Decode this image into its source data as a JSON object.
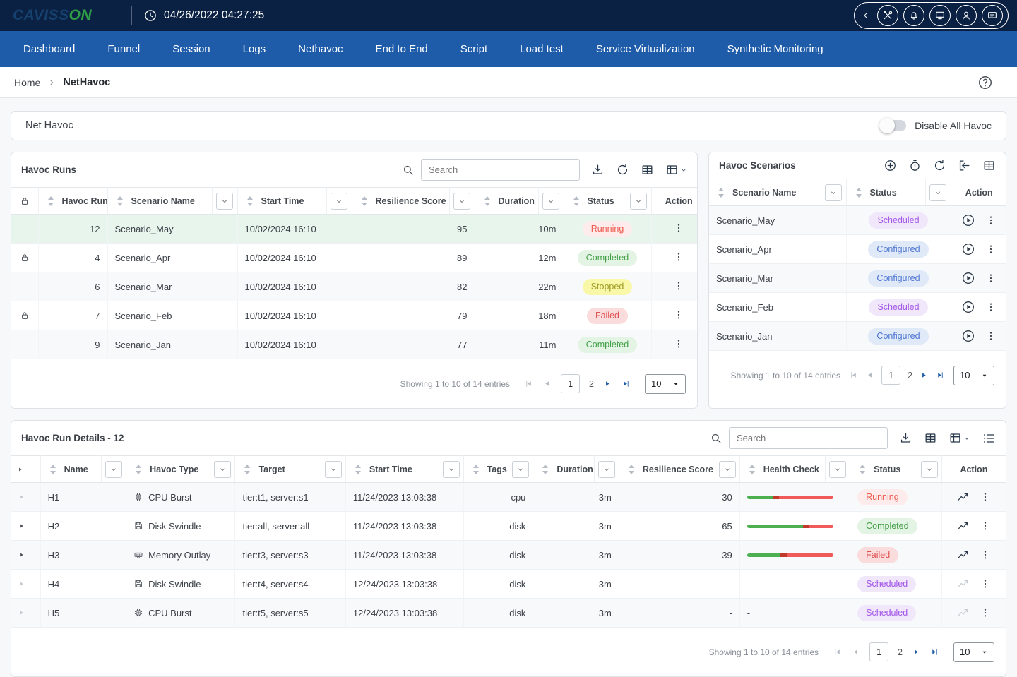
{
  "topbar": {
    "brand_part1": "CAVISS",
    "brand_part2": "ON",
    "timestamp": "04/26/2022 04:27:25"
  },
  "nav": {
    "items": [
      "Dashboard",
      "Funnel",
      "Session",
      "Logs",
      "Nethavoc",
      "End to End",
      "Script",
      "Load test",
      "Service Virtualization",
      "Synthetic Monitoring"
    ]
  },
  "breadcrumb": {
    "home": "Home",
    "current": "NetHavoc"
  },
  "net_havoc_bar": {
    "title": "Net Havoc",
    "toggle_label": "Disable All Havoc"
  },
  "havoc_runs": {
    "title": "Havoc Runs",
    "search_placeholder": "Search",
    "columns": [
      "Havoc Run",
      "Scenario Name",
      "Start Time",
      "Resilience Score",
      "Duration",
      "Status",
      "Action"
    ],
    "rows": [
      {
        "run": "12",
        "scenario": "Scenario_May",
        "start": "10/02/2024 16:10",
        "score": "95",
        "duration": "10m",
        "status": "Running",
        "status_class": "running"
      },
      {
        "run": "4",
        "scenario": "Scenario_Apr",
        "start": "10/02/2024 16:10",
        "score": "89",
        "duration": "12m",
        "status": "Completed",
        "status_class": "completed"
      },
      {
        "run": "6",
        "scenario": "Scenario_Mar",
        "start": "10/02/2024 16:10",
        "score": "82",
        "duration": "22m",
        "status": "Stopped",
        "status_class": "stopped"
      },
      {
        "run": "7",
        "scenario": "Scenario_Feb",
        "start": "10/02/2024 16:10",
        "score": "79",
        "duration": "18m",
        "status": "Failed",
        "status_class": "failed"
      },
      {
        "run": "9",
        "scenario": "Scenario_Jan",
        "start": "10/02/2024 16:10",
        "score": "77",
        "duration": "11m",
        "status": "Completed",
        "status_class": "completed"
      }
    ],
    "footer": {
      "showing": "Showing 1 to 10 of 14 entries",
      "page1": "1",
      "page2": "2",
      "page_size": "10"
    }
  },
  "havoc_scenarios": {
    "title": "Havoc Scenarios",
    "columns": [
      "Scenario Name",
      "Status",
      "Action"
    ],
    "rows": [
      {
        "name": "Scenario_May",
        "status": "Scheduled",
        "status_class": "scheduled"
      },
      {
        "name": "Scenario_Apr",
        "status": "Configured",
        "status_class": "configured"
      },
      {
        "name": "Scenario_Mar",
        "status": "Configured",
        "status_class": "configured"
      },
      {
        "name": "Scenario_Feb",
        "status": "Scheduled",
        "status_class": "scheduled"
      },
      {
        "name": "Scenario_Jan",
        "status": "Configured",
        "status_class": "configured"
      }
    ],
    "footer": {
      "showing": "Showing 1 to 10 of 14 entries",
      "page1": "1",
      "page2": "2",
      "page_size": "10"
    }
  },
  "run_details": {
    "title": "Havoc Run Details - 12",
    "search_placeholder": "Search",
    "columns": [
      "Name",
      "Havoc Type",
      "Target",
      "Start Time",
      "Tags",
      "Duration",
      "Resilience Score",
      "Health Check",
      "Status",
      "Action"
    ],
    "rows": [
      {
        "name": "H1",
        "type": "CPU Burst",
        "target": "tier:t1, server:s1",
        "start": "11/24/2023 13:03:38",
        "tags": "cpu",
        "duration": "3m",
        "score": "30",
        "health_pct": 30,
        "status": "Running",
        "status_class": "running"
      },
      {
        "name": "H2",
        "type": "Disk Swindle",
        "target": "tier:all, server:all",
        "start": "11/24/2023 13:03:38",
        "tags": "disk",
        "duration": "3m",
        "score": "65",
        "health_pct": 65,
        "status": "Completed",
        "status_class": "completed"
      },
      {
        "name": "H3",
        "type": "Memory Outlay",
        "target": "tier:t3, server:s3",
        "start": "11/24/2023 13:03:38",
        "tags": "disk",
        "duration": "3m",
        "score": "39",
        "health_pct": 39,
        "status": "Failed",
        "status_class": "failed"
      },
      {
        "name": "H4",
        "type": "Disk Swindle",
        "target": "tier:t4, server:s4",
        "start": "12/24/2023 13:03:38",
        "tags": "disk",
        "duration": "3m",
        "score": "-",
        "health_text": "-",
        "status": "Scheduled",
        "status_class": "scheduled"
      },
      {
        "name": "H5",
        "type": "CPU Burst",
        "target": "tier:t5, server:s5",
        "start": "12/24/2023 13:03:38",
        "tags": "disk",
        "duration": "3m",
        "score": "-",
        "health_text": "-",
        "status": "Scheduled",
        "status_class": "scheduled"
      }
    ],
    "footer": {
      "showing": "Showing 1 to 10 of 14 entries",
      "page1": "1",
      "page2": "2",
      "page_size": "10"
    }
  },
  "colors": {
    "topbar": "#0b2143",
    "nav": "#1e5caa",
    "selected_row": "#e7f5ec",
    "running_text": "#ef5b4e",
    "completed_text": "#43a047",
    "stopped_text": "#9e9d24",
    "failed_text": "#e05252",
    "scheduled_text": "#a256e8",
    "configured_text": "#4d74d2",
    "health_green": "#4caf50",
    "health_red": "#f05a5a"
  }
}
